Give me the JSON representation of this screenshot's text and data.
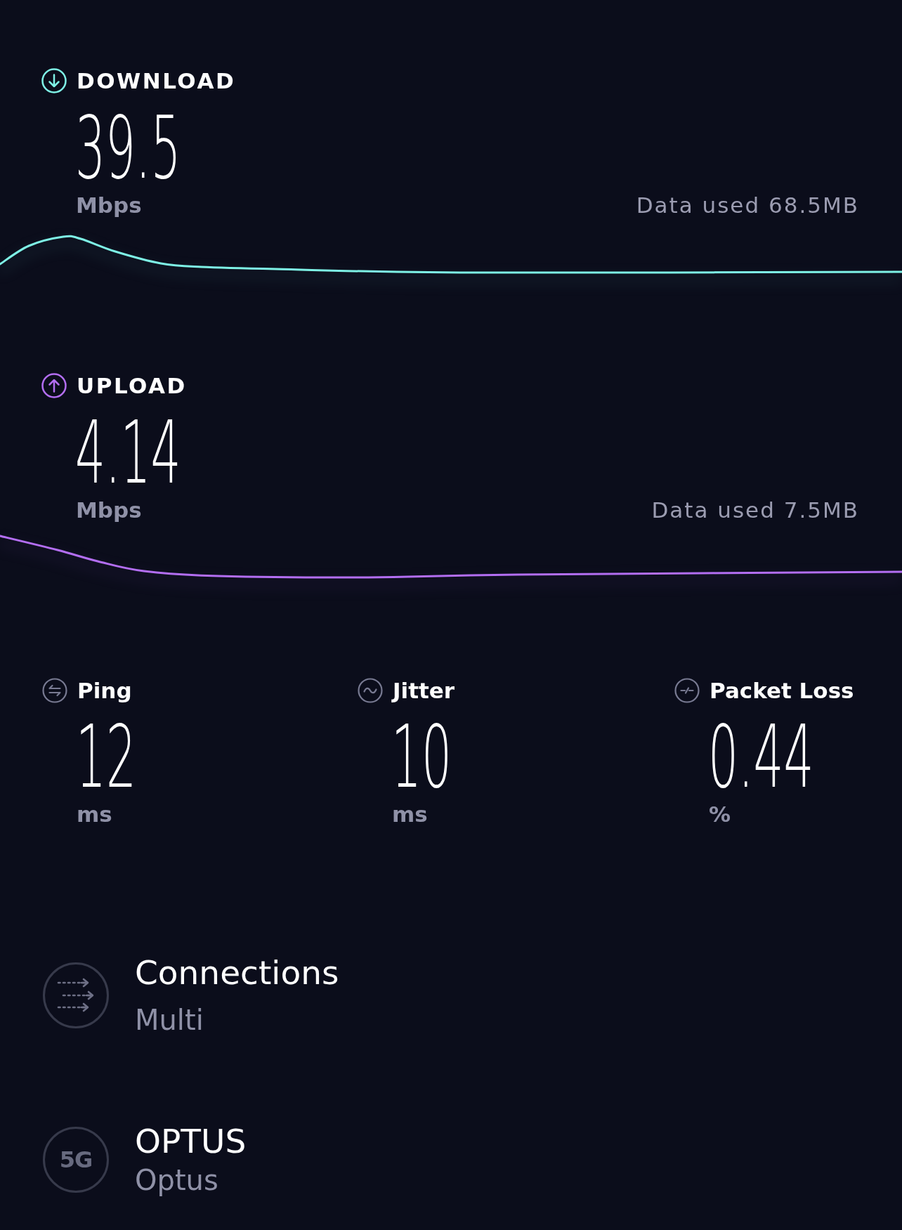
{
  "speeds": [
    {
      "kind": "download",
      "label": "DOWNLOAD",
      "value": "39.5",
      "unit": "Mbps",
      "data_used": "Data used 68.5MB",
      "color": "#7ef2e6"
    },
    {
      "kind": "upload",
      "label": "UPLOAD",
      "value": "4.14",
      "unit": "Mbps",
      "data_used": "Data used 7.5MB",
      "color": "#b36ef2"
    }
  ],
  "metrics": [
    {
      "kind": "ping",
      "label": "Ping",
      "value": "12",
      "unit": "ms"
    },
    {
      "kind": "jitter",
      "label": "Jitter",
      "value": "10",
      "unit": "ms"
    },
    {
      "kind": "packet_loss",
      "label": "Packet Loss",
      "value": "0.44",
      "unit": "%"
    }
  ],
  "details": [
    {
      "kind": "connections",
      "title": "Connections",
      "value": "Multi"
    },
    {
      "kind": "network",
      "badge": "5G",
      "title": "OPTUS",
      "value": "Optus"
    }
  ]
}
